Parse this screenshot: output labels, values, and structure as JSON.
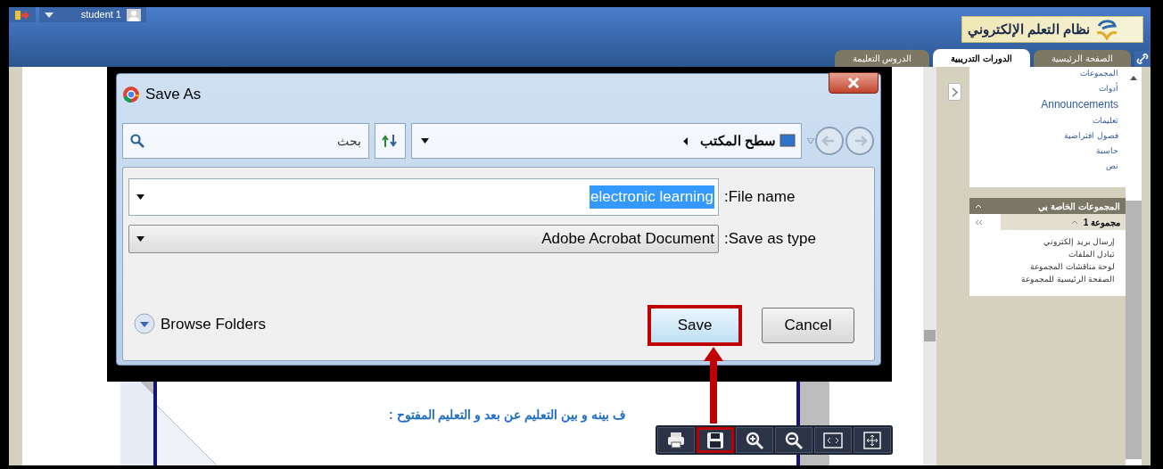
{
  "top_bar": {
    "user_name": "student 1"
  },
  "logo": {
    "title": "نظام التعلم الإلكتروني"
  },
  "tabs": [
    {
      "label": "الصفحة الرئيسية",
      "selected": false
    },
    {
      "label": "الدورات التدريبية",
      "selected": true
    },
    {
      "label": "الدروس التعليمة",
      "selected": false
    }
  ],
  "sidebar": {
    "menu_items": [
      {
        "label": "المجموعات",
        "kind": "small"
      },
      {
        "label": "أدوات",
        "kind": "small"
      },
      {
        "label": "Announcements",
        "kind": "large"
      },
      {
        "label": "تعليمات",
        "kind": "small"
      },
      {
        "label": "فصول افتراضية",
        "kind": "small"
      },
      {
        "label": "حاسبة",
        "kind": "small"
      },
      {
        "label": "نص",
        "kind": "small"
      }
    ],
    "groups_panel": {
      "title": "المجموعات الخاصة بي",
      "groups": [
        {
          "name": "مجموعة 1",
          "expanded": true,
          "links": [
            "إرسال بريد إلكتروني",
            "تبادل الملفات",
            "لوحة مناقشات المجموعة",
            "الصفحة الرئيسية للمجموعة"
          ]
        }
      ]
    }
  },
  "document": {
    "text": "ف بينه و بين التعليم عن بعد و التعليم المفتوح :"
  },
  "viewer_toolbar": {
    "buttons": [
      {
        "kind": "print",
        "highlighted": false
      },
      {
        "kind": "save",
        "highlighted": true
      },
      {
        "kind": "zoom_in",
        "highlighted": false
      },
      {
        "kind": "zoom_out",
        "highlighted": false
      },
      {
        "kind": "fit_width",
        "highlighted": false
      },
      {
        "kind": "fit_page",
        "highlighted": false
      }
    ]
  },
  "save_dialog": {
    "title": "Save As",
    "location": "سطح المكتب",
    "search": {
      "placeholder": "بحث"
    },
    "fields": [
      {
        "kind": "text",
        "label": ":File name",
        "value": "electronic learning"
      },
      {
        "kind": "select",
        "label": ":Save as type",
        "value": "Adobe Acrobat Document"
      }
    ],
    "browse_folders": "Browse Folders",
    "buttons": [
      {
        "label": "Cancel",
        "highlighted": false
      },
      {
        "label": "Save",
        "highlighted": true
      }
    ]
  }
}
